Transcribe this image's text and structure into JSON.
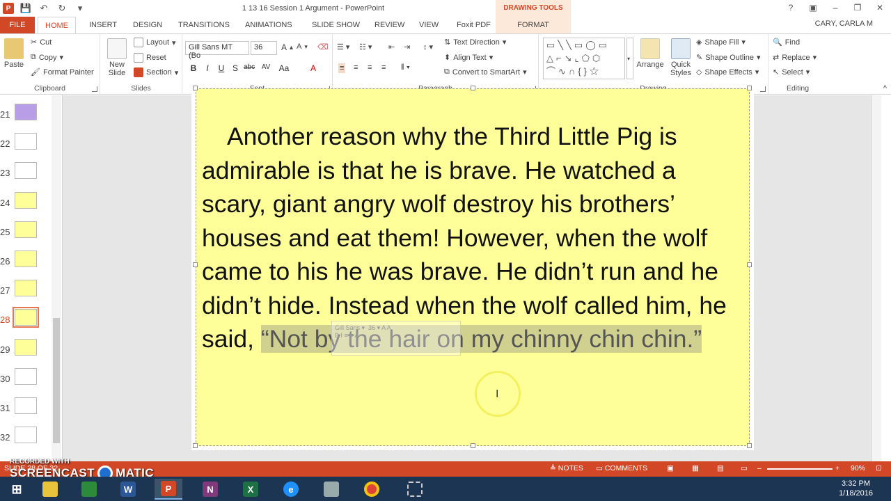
{
  "window": {
    "title": "1 13 16 Session 1 Argument - PowerPoint",
    "context_tab_group": "DRAWING TOOLS",
    "user": "CARY, CARLA M"
  },
  "tabs": [
    {
      "label": "FILE"
    },
    {
      "label": "HOME"
    },
    {
      "label": "INSERT"
    },
    {
      "label": "DESIGN"
    },
    {
      "label": "TRANSITIONS"
    },
    {
      "label": "ANIMATIONS"
    },
    {
      "label": "SLIDE SHOW"
    },
    {
      "label": "REVIEW"
    },
    {
      "label": "VIEW"
    },
    {
      "label": "Foxit PDF"
    },
    {
      "label": "FORMAT"
    }
  ],
  "ribbon": {
    "clipboard": {
      "label": "Clipboard",
      "paste": "Paste",
      "cut": "Cut",
      "copy": "Copy",
      "format_painter": "Format Painter"
    },
    "slides": {
      "label": "Slides",
      "new_slide": "New Slide",
      "layout": "Layout",
      "reset": "Reset",
      "section": "Section"
    },
    "font": {
      "label": "Font",
      "family": "Gill Sans MT (Bo",
      "size": "36"
    },
    "paragraph": {
      "label": "Paragraph",
      "text_direction": "Text Direction",
      "align_text": "Align Text",
      "convert_smartart": "Convert to SmartArt"
    },
    "drawing": {
      "label": "Drawing",
      "arrange": "Arrange",
      "quick_styles": "Quick Styles",
      "shape_fill": "Shape Fill",
      "shape_outline": "Shape Outline",
      "shape_effects": "Shape Effects"
    },
    "editing": {
      "label": "Editing",
      "find": "Find",
      "replace": "Replace",
      "select": "Select"
    }
  },
  "thumbnails": [
    {
      "num": "21",
      "color": "#b89ee6"
    },
    {
      "num": "22",
      "color": "#ffffff"
    },
    {
      "num": "23",
      "color": "#ffffff"
    },
    {
      "num": "24",
      "color": "#ffff99"
    },
    {
      "num": "25",
      "color": "#ffff99"
    },
    {
      "num": "26",
      "color": "#ffff99"
    },
    {
      "num": "27",
      "color": "#ffff99"
    },
    {
      "num": "28",
      "color": "#ffff99"
    },
    {
      "num": "29",
      "color": "#ffff99"
    },
    {
      "num": "30",
      "color": "#ffffff"
    },
    {
      "num": "31",
      "color": "#ffffff"
    },
    {
      "num": "32",
      "color": "#ffffff"
    }
  ],
  "selected_slide": "28",
  "slide": {
    "text_main": "Another reason why the Third Little Pig is admirable is that he is brave. He watched a scary, giant angry wolf destroy his brothers’ houses and eat them! However, when the wolf came to his he was brave. He didn’t run and he didn’t hide. Instead when the wolf called him, he said, ",
    "text_selected": "“Not by the hair on my chinny chin chin.”",
    "minibar_font": "Gill Sans",
    "minibar_size": "36"
  },
  "status": {
    "slide_info": "SLIDE 28 OF 32",
    "notes": "NOTES",
    "comments": "COMMENTS",
    "zoom": "90%"
  },
  "watermark": {
    "line1": "RECORDED WITH",
    "line2a": "SCREENCAST",
    "line2b": "MATIC"
  },
  "taskbar": {
    "time": "3:32 PM",
    "date": "1/18/2016"
  },
  "colors": {
    "accent": "#d24726",
    "slide_bg": "#ffff99",
    "taskbar": "#1c3552"
  }
}
